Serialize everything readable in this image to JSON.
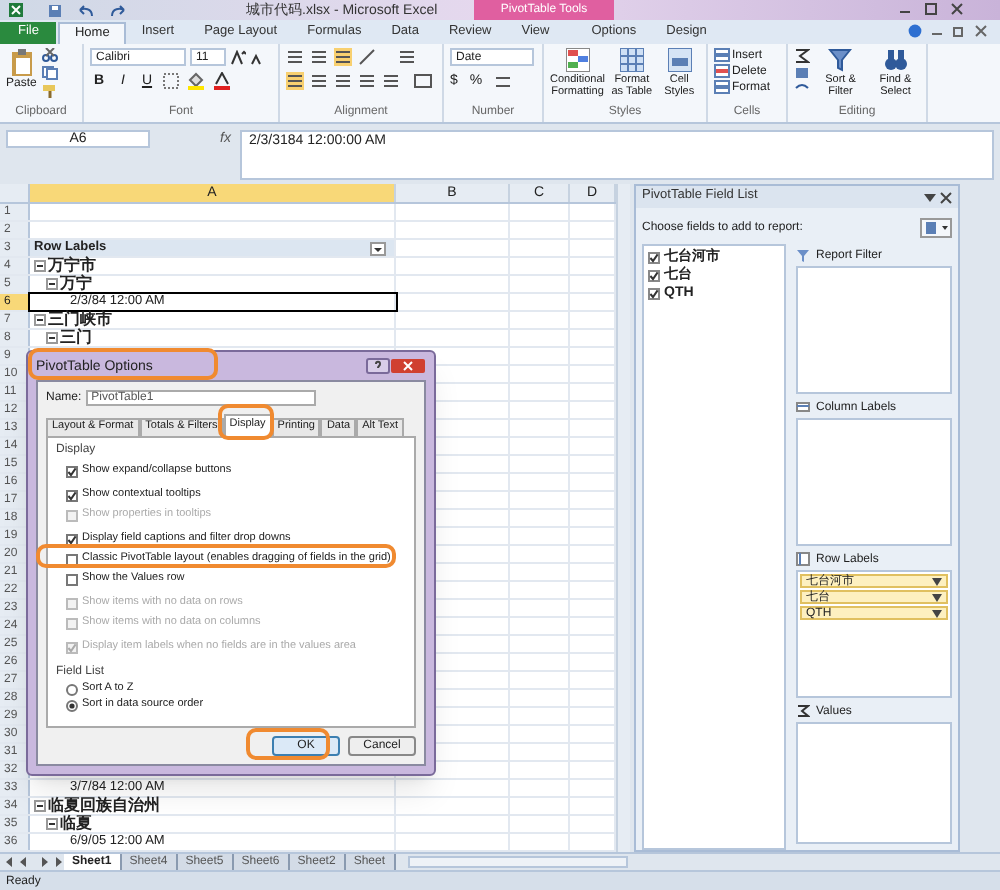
{
  "window": {
    "title": "城市代码.xlsx - Microsoft Excel",
    "context_tab": "PivotTable Tools"
  },
  "ribbon_tabs": [
    {
      "label": "File",
      "kind": "file",
      "selected": false
    },
    {
      "label": "Home",
      "kind": "tab",
      "selected": true
    },
    {
      "label": "Insert",
      "kind": "tab",
      "selected": false
    },
    {
      "label": "Page Layout",
      "kind": "tab",
      "selected": false
    },
    {
      "label": "Formulas",
      "kind": "tab",
      "selected": false
    },
    {
      "label": "Data",
      "kind": "tab",
      "selected": false
    },
    {
      "label": "Review",
      "kind": "tab",
      "selected": false
    },
    {
      "label": "View",
      "kind": "tab",
      "selected": false
    },
    {
      "label": "Options",
      "kind": "context",
      "selected": false
    },
    {
      "label": "Design",
      "kind": "context",
      "selected": false
    }
  ],
  "ribbon": {
    "paste": "Paste",
    "font_name": "Calibri",
    "font_size": "11",
    "font_buttons": [
      "B",
      "I",
      "U"
    ],
    "number_format": "Date",
    "currency": "$",
    "percent": "%",
    "styles_buttons": [
      "Conditional Formatting",
      "Format as Table",
      "Cell Styles"
    ],
    "cells_buttons": [
      "Insert",
      "Delete",
      "Format"
    ],
    "editing_buttons": [
      "Sort & Filter",
      "Find & Select"
    ],
    "groups": [
      "Clipboard",
      "Font",
      "Alignment",
      "Number",
      "Styles",
      "Cells",
      "Editing"
    ]
  },
  "formula_bar": {
    "name_box": "A6",
    "fx": "fx",
    "value": "2/3/3184 12:00:00 AM"
  },
  "columns": [
    {
      "label": "A",
      "selected": true
    },
    {
      "label": "B",
      "selected": false
    },
    {
      "label": "C",
      "selected": false
    },
    {
      "label": "D",
      "selected": false
    }
  ],
  "rows": [
    {
      "number": "1",
      "selected": false
    },
    {
      "number": "2",
      "selected": false
    },
    {
      "number": "3",
      "kind": "header",
      "text": "Row Labels",
      "selected": false
    },
    {
      "number": "4",
      "kind": "group",
      "text": "万宁市",
      "selected": false
    },
    {
      "number": "5",
      "kind": "subgroup",
      "text": "万宁",
      "selected": false
    },
    {
      "number": "6",
      "kind": "date",
      "text": "2/3/84 12:00 AM",
      "selected": true
    },
    {
      "number": "7",
      "kind": "group",
      "text": "三门峡市",
      "selected": false
    },
    {
      "number": "8",
      "kind": "subgroup",
      "text": "三门",
      "selected": false
    },
    {
      "number": "9",
      "selected": false
    },
    {
      "number": "10",
      "selected": false
    },
    {
      "number": "11",
      "selected": false
    },
    {
      "number": "12",
      "selected": false
    },
    {
      "number": "13",
      "selected": false
    },
    {
      "number": "14",
      "selected": false
    },
    {
      "number": "15",
      "selected": false
    },
    {
      "number": "16",
      "selected": false
    },
    {
      "number": "17",
      "selected": false
    },
    {
      "number": "18",
      "selected": false
    },
    {
      "number": "19",
      "selected": false
    },
    {
      "number": "20",
      "selected": false
    },
    {
      "number": "21",
      "selected": false
    },
    {
      "number": "22",
      "selected": false
    },
    {
      "number": "23",
      "selected": false
    },
    {
      "number": "24",
      "selected": false
    },
    {
      "number": "25",
      "selected": false
    },
    {
      "number": "26",
      "selected": false
    },
    {
      "number": "27",
      "selected": false
    },
    {
      "number": "28",
      "selected": false
    },
    {
      "number": "29",
      "selected": false
    },
    {
      "number": "30",
      "selected": false
    },
    {
      "number": "31",
      "selected": false
    },
    {
      "number": "32",
      "selected": false
    },
    {
      "number": "33",
      "kind": "date",
      "text": "3/7/84 12:00 AM",
      "selected": false
    },
    {
      "number": "34",
      "kind": "group",
      "text": "临夏回族自治州",
      "selected": false
    },
    {
      "number": "35",
      "kind": "subgroup",
      "text": "临夏",
      "selected": false
    },
    {
      "number": "36",
      "kind": "date",
      "text": "6/9/05 12:00 AM",
      "selected": false
    }
  ],
  "sheet_tabs": [
    {
      "label": "Sheet1",
      "selected": true
    },
    {
      "label": "Sheet4",
      "selected": false
    },
    {
      "label": "Sheet5",
      "selected": false
    },
    {
      "label": "Sheet6",
      "selected": false
    },
    {
      "label": "Sheet2",
      "selected": false
    },
    {
      "label": "Sheet",
      "selected": false
    }
  ],
  "status_bar": "Ready",
  "field_list": {
    "title": "PivotTable Field List",
    "prompt": "Choose fields to add to report:",
    "fields": [
      {
        "name": "七台河市",
        "checked": true
      },
      {
        "name": "七台",
        "checked": true
      },
      {
        "name": "QTH",
        "checked": true
      }
    ],
    "areas": [
      {
        "title": "Report Filter",
        "kind": "filter"
      },
      {
        "title": "Column Labels",
        "kind": "columns"
      },
      {
        "title": "Row Labels",
        "kind": "rows",
        "items": [
          "七台河市",
          "七台",
          "QTH"
        ]
      },
      {
        "title": "Values",
        "kind": "values"
      }
    ]
  },
  "dialog": {
    "title": "PivotTable Options",
    "name_label": "Name:",
    "name_value": "PivotTable1",
    "tabs": [
      {
        "label": "Layout & Format",
        "selected": false
      },
      {
        "label": "Totals & Filters",
        "selected": false
      },
      {
        "label": "Display",
        "selected": true
      },
      {
        "label": "Printing",
        "selected": false
      },
      {
        "label": "Data",
        "selected": false
      },
      {
        "label": "Alt Text",
        "selected": false
      }
    ],
    "section": "Display",
    "options": [
      {
        "label": "Show expand/collapse buttons",
        "checked": true,
        "disabled": false,
        "gap": false
      },
      {
        "label": "Show contextual tooltips",
        "checked": true,
        "disabled": false,
        "gap": true
      },
      {
        "label": "Show properties in tooltips",
        "checked": false,
        "disabled": true,
        "gap": false
      },
      {
        "label": "Display field captions and filter drop downs",
        "checked": true,
        "disabled": false,
        "gap": true
      },
      {
        "label": "Classic PivotTable layout (enables dragging of fields in the grid)",
        "checked": false,
        "disabled": false,
        "gap": false
      },
      {
        "label": "Show the Values row",
        "checked": false,
        "disabled": false,
        "gap": false
      },
      {
        "label": "Show items with no data on rows",
        "checked": false,
        "disabled": true,
        "gap": true
      },
      {
        "label": "Show items with no data on columns",
        "checked": false,
        "disabled": true,
        "gap": false
      },
      {
        "label": "Display item labels when no fields are in the values area",
        "checked": true,
        "disabled": true,
        "gap": true
      }
    ],
    "field_list_section": "Field List",
    "sort_options": [
      {
        "label": "Sort A to Z",
        "selected": false
      },
      {
        "label": "Sort in data source order",
        "selected": true
      }
    ],
    "buttons": [
      {
        "label": "OK",
        "kind": "default"
      },
      {
        "label": "Cancel",
        "kind": "normal"
      }
    ]
  }
}
